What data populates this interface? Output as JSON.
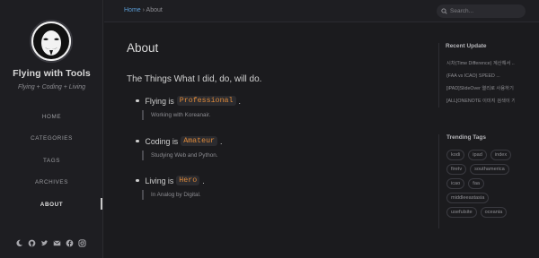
{
  "site": {
    "title": "Flying with Tools",
    "subtitle": "Flying + Coding + Living"
  },
  "nav": {
    "home": "HOME",
    "categories": "CATEGORIES",
    "tags": "TAGS",
    "archives": "ARCHIVES",
    "about": "ABOUT"
  },
  "sidebar_icons": [
    "moon-icon",
    "github-icon",
    "twitter-icon",
    "email-icon",
    "facebook-icon",
    "instagram-icon"
  ],
  "breadcrumb": {
    "home": "Home",
    "separator": "›",
    "current": "About"
  },
  "search": {
    "placeholder": "Search..."
  },
  "page": {
    "title": "About",
    "intro": "The Things What I did, do, will do.",
    "items": [
      {
        "prefix": "Flying is",
        "code": "Professional",
        "suffix": ".",
        "note": "Working with Koreanair."
      },
      {
        "prefix": "Coding is",
        "code": "Amateur",
        "suffix": ".",
        "note": "Studying Web and Python."
      },
      {
        "prefix": "Living is",
        "code": "Hero",
        "suffix": ".",
        "note": "In Analog by Digital."
      }
    ]
  },
  "recent_update": {
    "title": "Recent Update",
    "items": [
      "시차(Time Difference) 계산해서 ...",
      "(FAA vs ICAO) SPEED ...",
      "[iPAD]SlideOver 열리로 사용하기 ...",
      "[ALL]ONENOTE 이미지 검색이 가 ..."
    ]
  },
  "trending_tags": {
    "title": "Trending Tags",
    "tags": [
      "kodi",
      "ipad",
      "index",
      "firetv",
      "southamerica",
      "icao",
      "faa",
      "middleeastasia",
      "usefulsite",
      "oceania"
    ]
  },
  "colors": {
    "background": "#1b1b1e",
    "sidebar": "#1e1e22",
    "link": "#5a9bd4",
    "code": "#e08a3a"
  }
}
